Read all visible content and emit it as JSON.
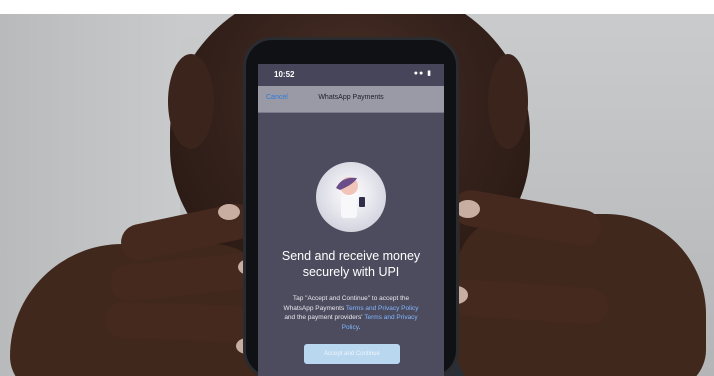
{
  "phone": {
    "status": {
      "time": "10:52"
    },
    "nav": {
      "cancel": "Cancel",
      "title": "WhatsApp Payments"
    },
    "headline_line1": "Send and receive money",
    "headline_line2": "securely with UPI",
    "body": {
      "t1": "Tap \"Accept and Continue\" to accept the",
      "t2": "WhatsApp Payments ",
      "l1": "Terms and Privacy Policy",
      "t3": "and the payment providers' ",
      "l2": "Terms and Privacy",
      "l3": "Policy",
      "t4": "."
    },
    "button": "Accept and Continue"
  },
  "colors": {
    "screen_bg": "#4d4c5e",
    "link": "#7fb6ff",
    "button": "#b9d7ee"
  }
}
